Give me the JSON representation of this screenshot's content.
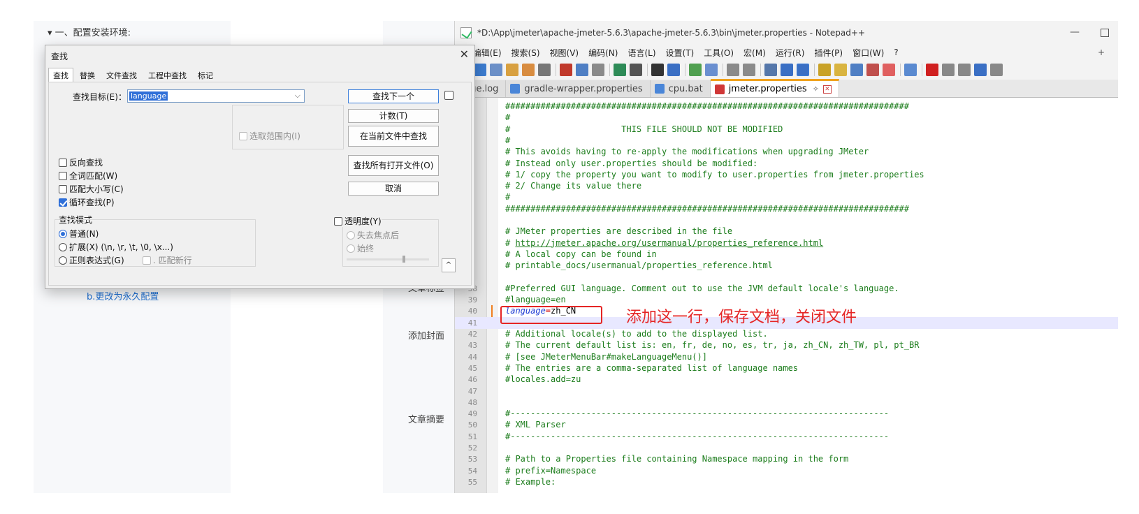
{
  "background_article": {
    "outline_top": "▾ 一、配置安装环境:",
    "outline_b": "b.更改为永久配置",
    "form_labels": [
      "文章标签",
      "添加封面",
      "文章摘要"
    ]
  },
  "notepad": {
    "title": "*D:\\App\\jmeter\\apache-jmeter-5.6.3\\apache-jmeter-5.6.3\\bin\\jmeter.properties - Notepad++",
    "window_min": "—",
    "menu": [
      "F)",
      "编辑(E)",
      "搜索(S)",
      "视图(V)",
      "编码(N)",
      "语言(L)",
      "设置(T)",
      "工具(O)",
      "宏(M)",
      "运行(R)",
      "插件(P)",
      "窗口(W)",
      "?"
    ],
    "menu_plus": "+",
    "tabs": [
      {
        "label": "ange.log",
        "active": false
      },
      {
        "label": "gradle-wrapper.properties",
        "active": false
      },
      {
        "label": "cpu.bat",
        "active": false
      },
      {
        "label": "jmeter.properties",
        "active": true
      }
    ],
    "tab_pin": "✧",
    "tab_close": "✕",
    "lines": [
      {
        "n": "",
        "text": "################################################################################"
      },
      {
        "n": "",
        "text": "#"
      },
      {
        "n": "",
        "text": "#                      THIS FILE SHOULD NOT BE MODIFIED"
      },
      {
        "n": "",
        "text": "#"
      },
      {
        "n": "",
        "text": "# This avoids having to re-apply the modifications when upgrading JMeter"
      },
      {
        "n": "",
        "text": "# Instead only user.properties should be modified:"
      },
      {
        "n": "",
        "text": "# 1/ copy the property you want to modify to user.properties from jmeter.properties"
      },
      {
        "n": "",
        "text": "# 2/ Change its value there"
      },
      {
        "n": "",
        "text": "#"
      },
      {
        "n": "",
        "text": "################################################################################"
      },
      {
        "n": "",
        "text": ""
      },
      {
        "n": "",
        "text": "# JMeter properties are described in the file"
      },
      {
        "n": "",
        "text": "# http://jmeter.apache.org/usermanual/properties_reference.html",
        "link": true
      },
      {
        "n": "",
        "text": "# A local copy can be found in"
      },
      {
        "n": "",
        "text": "# printable_docs/usermanual/properties_reference.html"
      },
      {
        "n": "",
        "text": ""
      },
      {
        "n": "38",
        "text": "#Preferred GUI language. Comment out to use the JVM default locale's language."
      },
      {
        "n": "39",
        "text": "#language=en"
      },
      {
        "n": "40",
        "text": "",
        "kv": {
          "key": "language",
          "eq": "=",
          "val": "zh_CN"
        }
      },
      {
        "n": "41",
        "text": "",
        "current": true
      },
      {
        "n": "42",
        "text": "# Additional locale(s) to add to the displayed list."
      },
      {
        "n": "43",
        "text": "# The current default list is: en, fr, de, no, es, tr, ja, zh_CN, zh_TW, pl, pt_BR"
      },
      {
        "n": "44",
        "text": "# [see JMeterMenuBar#makeLanguageMenu()]"
      },
      {
        "n": "45",
        "text": "# The entries are a comma-separated list of language names"
      },
      {
        "n": "46",
        "text": "#locales.add=zu"
      },
      {
        "n": "47",
        "text": ""
      },
      {
        "n": "48",
        "text": ""
      },
      {
        "n": "49",
        "text": "#---------------------------------------------------------------------------"
      },
      {
        "n": "50",
        "text": "# XML Parser"
      },
      {
        "n": "51",
        "text": "#---------------------------------------------------------------------------"
      },
      {
        "n": "52",
        "text": ""
      },
      {
        "n": "53",
        "text": "# Path to a Properties file containing Namespace mapping in the form"
      },
      {
        "n": "54",
        "text": "# prefix=Namespace"
      },
      {
        "n": "55",
        "text": "# Example:"
      }
    ],
    "annotation": "添加这一行，保存文档，关闭文件",
    "colors": {
      "annotation": "#e52525",
      "comment": "#1b7c1b",
      "key": "#1d3bd4",
      "tab_accent": "#f0a21d"
    }
  },
  "find_dialog": {
    "title": "查找",
    "close": "✕",
    "tabs": [
      "查找",
      "替换",
      "文件查找",
      "工程中查找",
      "标记"
    ],
    "target_label": "查找目标(E)：",
    "target_value": "language",
    "buttons": {
      "find_next": "查找下一个",
      "count": "计数(T)",
      "find_in_current": "在当前文件中查找",
      "find_in_all_open": "查找所有打开文件(O)",
      "cancel": "取消",
      "collapse": "^"
    },
    "in_selection": "选取范围内(I)",
    "options": [
      {
        "label": "反向查找",
        "checked": false
      },
      {
        "label": "全词匹配(W)",
        "checked": false
      },
      {
        "label": "匹配大小写(C)",
        "checked": false
      },
      {
        "label": "循环查找(P)",
        "checked": true
      }
    ],
    "mode_title": "查找模式",
    "modes": [
      {
        "label": "普通(N)",
        "checked": true
      },
      {
        "label": "扩展(X) (\\n, \\r, \\t, \\0, \\x...)",
        "checked": false
      },
      {
        "label": "正则表达式(G)",
        "checked": false
      }
    ],
    "match_newline": ". 匹配新行",
    "transparency": "透明度(Y)",
    "transparency_opts": [
      "失去焦点后",
      "始终"
    ]
  }
}
